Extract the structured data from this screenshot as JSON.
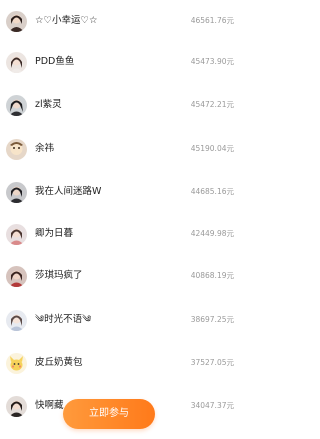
{
  "colors": {
    "button_gradient_start": "#ff9a3c",
    "button_gradient_end": "#ff7a1a",
    "name_text": "#222222",
    "amount_text": "#9a9a9a"
  },
  "leaderboard": [
    {
      "name": "☆♡小幸运♡☆",
      "amount": "46561.76元"
    },
    {
      "name": "PDD鱼鱼",
      "amount": "45473.90元"
    },
    {
      "name": "zl紫灵",
      "amount": "45472.21元"
    },
    {
      "name": "余祎",
      "amount": "45190.04元"
    },
    {
      "name": "我在人间迷路W",
      "amount": "44685.16元"
    },
    {
      "name": "卿为日暮",
      "amount": "42449.98元"
    },
    {
      "name": "莎琪玛疯了",
      "amount": "40868.19元"
    },
    {
      "name": "༄时光不语༄",
      "amount": "38697.25元"
    },
    {
      "name": "皮丘奶黄包",
      "amount": "37527.05元"
    },
    {
      "name": "快啊藏",
      "amount": "34047.37元"
    }
  ],
  "join_button": {
    "label": "立即参与"
  }
}
